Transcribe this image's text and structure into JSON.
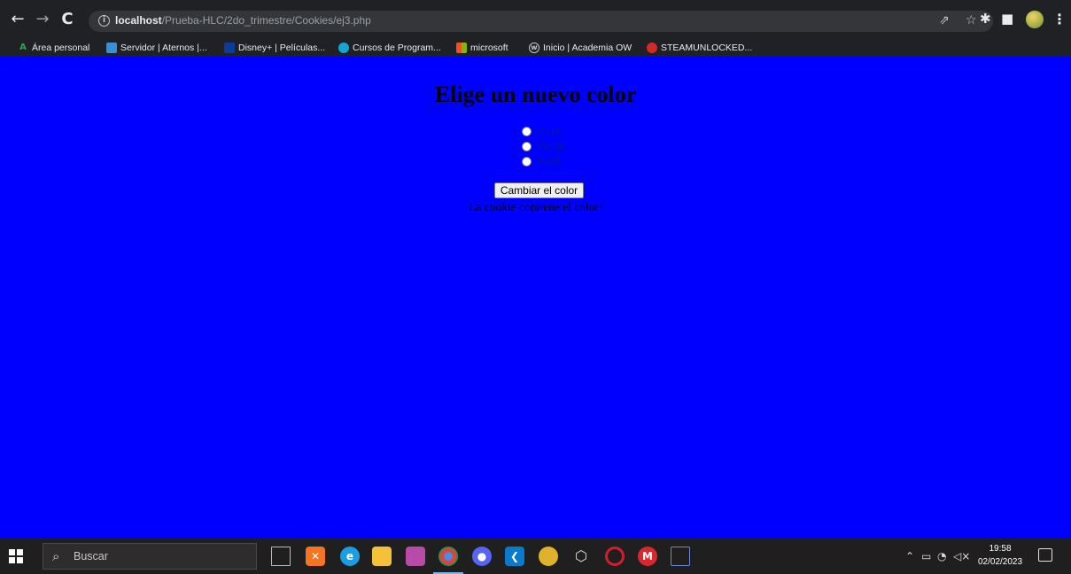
{
  "browser": {
    "url_host": "localhost",
    "url_path": "/Prueba-HLC/2do_trimestre/Cookies/ej3.php",
    "bookmarks": [
      {
        "label": "Área personal",
        "icon": "aula-icon",
        "color": "#2ea84a"
      },
      {
        "label": "Servidor | Aternos |...",
        "icon": "aternos-icon",
        "color": "#3b8fd6"
      },
      {
        "label": "Disney+ | Películas...",
        "icon": "disney-icon",
        "color": "#0b3c9a"
      },
      {
        "label": "Cursos de Program...",
        "icon": "courses-icon",
        "color": "#14a4d6"
      },
      {
        "label": "microsoft",
        "icon": "microsoft-icon",
        "color": "#f25022"
      },
      {
        "label": "Inicio | Academia OW",
        "icon": "academia-icon",
        "color": "#5b5bd6"
      },
      {
        "label": "STEAMUNLOCKED...",
        "icon": "steamunlocked-icon",
        "color": "#d62828"
      }
    ]
  },
  "page": {
    "title": "Elige un nuevo color",
    "options": [
      "Rojo",
      "Verde",
      "Azul"
    ],
    "submit_label": "Cambiar el color",
    "cookie_text": "La cookie contiene el color:",
    "background_color": "#0000ff"
  },
  "taskbar": {
    "search_placeholder": "Buscar",
    "time": "19:58",
    "date": "02/02/2023",
    "apps": [
      {
        "name": "task-view",
        "color": "#3a3a3a"
      },
      {
        "name": "xampp",
        "color": "#f47421"
      },
      {
        "name": "edge",
        "color": "#1b9de2"
      },
      {
        "name": "file-explorer",
        "color": "#f3c13a"
      },
      {
        "name": "game-app",
        "color": "#b84aa8"
      },
      {
        "name": "chrome",
        "color": "#4a8be8",
        "active": true
      },
      {
        "name": "discord",
        "color": "#5865f2"
      },
      {
        "name": "vscode",
        "color": "#0a7acc"
      },
      {
        "name": "notes-app",
        "color": "#e0b12c"
      },
      {
        "name": "virtualbox",
        "color": "#4a4a4a"
      },
      {
        "name": "opera",
        "color": "#d21e2b"
      },
      {
        "name": "mega",
        "color": "#d9272e"
      },
      {
        "name": "snipping-tool",
        "color": "#2d5ad6"
      }
    ]
  }
}
